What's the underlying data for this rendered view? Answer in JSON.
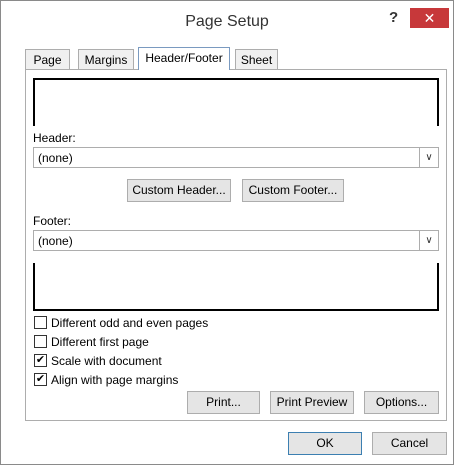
{
  "window": {
    "title": "Page Setup",
    "help_label": "?",
    "close_label": "✕"
  },
  "tabs": [
    {
      "label": "Page"
    },
    {
      "label": "Margins"
    },
    {
      "label": "Header/Footer"
    },
    {
      "label": "Sheet"
    }
  ],
  "header": {
    "label": "Header:",
    "value": "(none)"
  },
  "buttons": {
    "custom_header": "Custom Header...",
    "custom_footer": "Custom Footer...",
    "print": "Print...",
    "print_preview": "Print Preview",
    "options": "Options...",
    "ok": "OK",
    "cancel": "Cancel"
  },
  "footer": {
    "label": "Footer:",
    "value": "(none)"
  },
  "checkboxes": [
    {
      "label": "Different odd and even pages",
      "checked": false
    },
    {
      "label": "Different first page",
      "checked": false
    },
    {
      "label": "Scale with document",
      "checked": true
    },
    {
      "label": "Align with page margins",
      "checked": true
    }
  ],
  "dropdown_arrow": "∨"
}
